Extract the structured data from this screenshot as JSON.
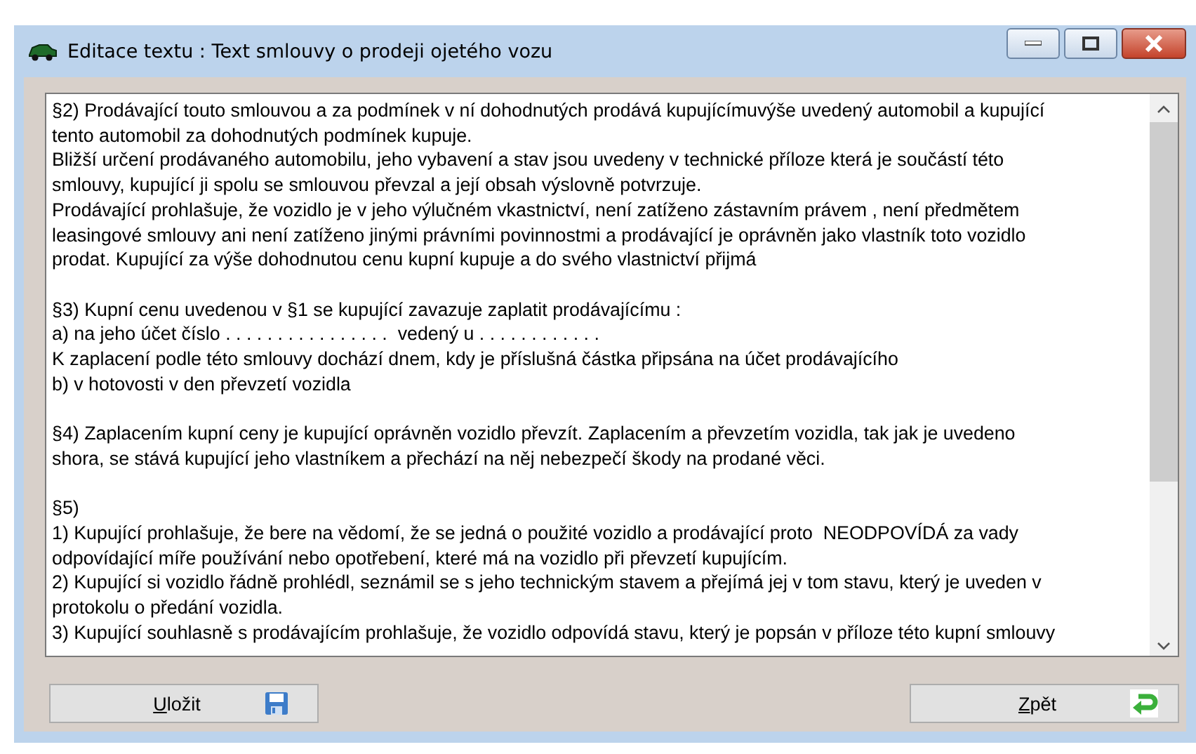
{
  "window": {
    "title": "Editace textu : Text smlouvy o prodeji ojetého vozu"
  },
  "text_area": {
    "paragraphs": [
      {
        "lines": [
          "§2) Prodávající touto smlouvou a za podmínek v ní dohodnutých prodává kupujícímuvýše uvedený automobil a kupující",
          "tento automobil za dohodnutých podmínek kupuje.",
          "Bližší určení prodávaného automobilu, jeho vybavení a stav jsou uvedeny v technické příloze která je součástí této",
          "smlouvy, kupující ji spolu se smlouvou převzal a její obsah výslovně potvrzuje.",
          "Prodávající prohlašuje, že vozidlo je v jeho výlučném vkastnictví, není zatíženo zástavním právem , není předmětem",
          "leasingové smlouvy ani není zatíženo jinými právními povinnostmi a prodávající je oprávněn jako vlastník toto vozidlo",
          "prodat. Kupující za výše dohodnutou cenu kupní kupuje a do svého vlastnictví přijmá"
        ]
      },
      {
        "lines": [
          "§3) Kupní cenu uvedenou v §1 se kupující zavazuje zaplatit prodávajícímu :",
          "a) na jeho účet číslo . . . . . . . . . . . . . . . .  vedený u . . . . . . . . . . . .",
          "K zaplacení podle této smlouvy dochází dnem, kdy je příslušná částka připsána na účet prodávajícího",
          "b) v hotovosti v den převzetí vozidla"
        ]
      },
      {
        "lines": [
          "§4) Zaplacením kupní ceny je kupující oprávněn vozidlo převzít. Zaplacením a převzetím vozidla, tak jak je uvedeno",
          "shora, se stává kupující jeho vlastníkem a přechází na něj nebezpečí škody na prodané věci."
        ]
      },
      {
        "lines": [
          "§5)",
          "1) Kupující prohlašuje, že bere na vědomí, že se jedná o použité vozidlo a prodávající proto  NEODPOVÍDÁ za vady",
          "odpovídající míře používání nebo opotřebení, které má na vozidlo při převzetí kupujícím.",
          "2) Kupující si vozidlo řádně prohlédl, seznámil se s jeho technickým stavem a přejímá jej v tom stavu, který je uveden v",
          "protokolu o předání vozidla.",
          "3) Kupující souhlasně s prodávajícím prohlašuje, že vozidlo odpovídá stavu, který je popsán v příloze této kupní smlouvy"
        ]
      }
    ]
  },
  "buttons": [
    {
      "kind": "save",
      "mnemonic": "U",
      "rest": "ložit"
    },
    {
      "kind": "back",
      "mnemonic": "Z",
      "rest": "pět"
    }
  ]
}
